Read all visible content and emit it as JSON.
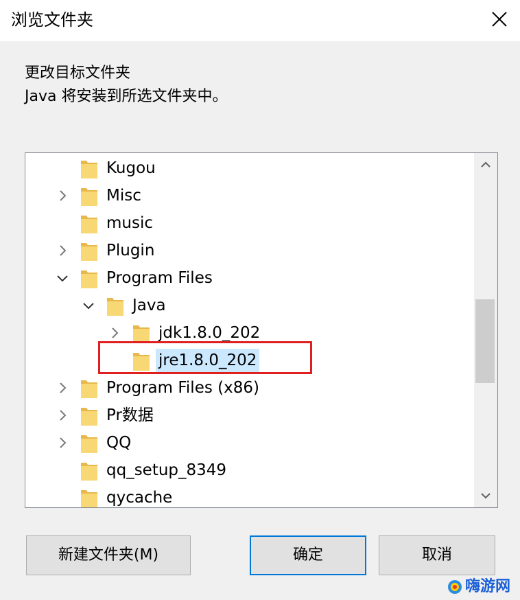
{
  "window": {
    "title": "浏览文件夹"
  },
  "header": {
    "heading": "更改目标文件夹",
    "description": "Java 将安装到所选文件夹中。"
  },
  "tree": {
    "items": [
      {
        "label": "Kugou",
        "depth": 0,
        "expander": "none",
        "selected": false
      },
      {
        "label": "Misc",
        "depth": 0,
        "expander": "collapsed",
        "selected": false
      },
      {
        "label": "music",
        "depth": 0,
        "expander": "none",
        "selected": false
      },
      {
        "label": "Plugin",
        "depth": 0,
        "expander": "collapsed",
        "selected": false
      },
      {
        "label": "Program Files",
        "depth": 0,
        "expander": "expanded",
        "selected": false
      },
      {
        "label": "Java",
        "depth": 1,
        "expander": "expanded",
        "selected": false
      },
      {
        "label": "jdk1.8.0_202",
        "depth": 2,
        "expander": "collapsed",
        "selected": false
      },
      {
        "label": "jre1.8.0_202",
        "depth": 2,
        "expander": "none",
        "selected": true
      },
      {
        "label": "Program Files (x86)",
        "depth": 0,
        "expander": "collapsed",
        "selected": false
      },
      {
        "label": "Pr数据",
        "depth": 0,
        "expander": "collapsed",
        "selected": false
      },
      {
        "label": "QQ",
        "depth": 0,
        "expander": "collapsed",
        "selected": false
      },
      {
        "label": "qq_setup_8349",
        "depth": 0,
        "expander": "none",
        "selected": false
      },
      {
        "label": "qycache",
        "depth": 0,
        "expander": "none",
        "selected": false
      }
    ],
    "scroll_position": 0.55
  },
  "buttons": {
    "new_folder": "新建文件夹(M)",
    "ok": "确定",
    "cancel": "取消"
  },
  "watermark": {
    "text": "嗨游网"
  },
  "colors": {
    "selection": "#cce8ff",
    "highlight_box": "#e02020",
    "default_button_border": "#0078d7",
    "folder": "#f8d775"
  },
  "icons": {
    "close": "close-icon",
    "folder": "folder-icon",
    "chevron_right": "chevron-right-icon",
    "chevron_down": "chevron-down-icon",
    "scroll_up": "chevron-up-icon",
    "scroll_down": "chevron-down-icon"
  }
}
